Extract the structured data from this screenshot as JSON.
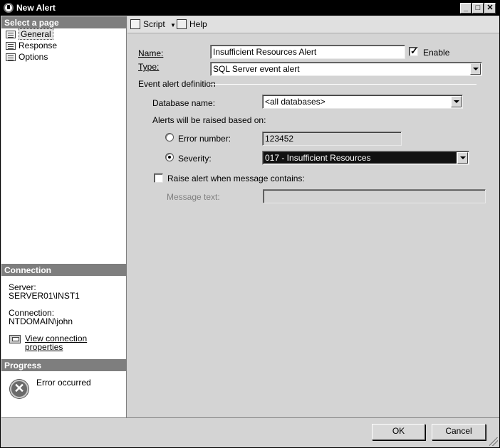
{
  "window": {
    "title": "New Alert"
  },
  "left_pane": {
    "select_page_header": "Select a page",
    "pages": [
      {
        "label": "General",
        "selected": true
      },
      {
        "label": "Response",
        "selected": false
      },
      {
        "label": "Options",
        "selected": false
      }
    ],
    "connection_header": "Connection",
    "server_label": "Server:",
    "server_value": "SERVER01\\INST1",
    "connection_label": "Connection:",
    "connection_value": "NTDOMAIN\\john",
    "view_connection_link": "View connection properties",
    "progress_header": "Progress",
    "progress_status": "Error occurred"
  },
  "toolbar": {
    "script_label": "Script",
    "help_label": "Help"
  },
  "form": {
    "name_label": "Name:",
    "name_value": "Insufficient Resources Alert",
    "enable_label": "Enable",
    "enable_checked": true,
    "type_label": "Type:",
    "type_value": "SQL Server event alert",
    "group_title": "Event alert definition",
    "database_label": "Database name:",
    "database_value": "<all databases>",
    "raised_label": "Alerts will be raised based on:",
    "error_number_label": "Error number:",
    "error_number_value": "123452",
    "severity_label": "Severity:",
    "severity_value": "017 - Insufficient Resources",
    "raise_alert_label": "Raise alert when message contains:",
    "raise_alert_checked": false,
    "message_text_label": "Message text:",
    "message_text_value": ""
  },
  "buttons": {
    "ok_label": "OK",
    "cancel_label": "Cancel"
  },
  "title_buttons": {
    "minimize": "_",
    "maximize": "□",
    "close": "✕"
  }
}
